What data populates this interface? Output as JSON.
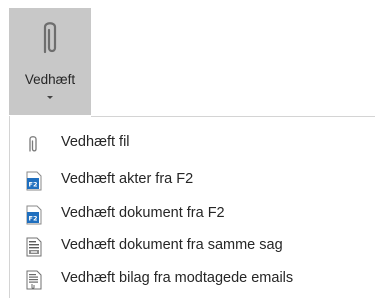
{
  "button": {
    "label": "Vedhæft",
    "icon": "paperclip-icon"
  },
  "menu": {
    "items": [
      {
        "label": "Vedhæft fil",
        "icon": "paperclip-icon"
      },
      {
        "label": "Vedhæft akter fra F2",
        "icon": "f2-document-icon",
        "icon_text": "F2"
      },
      {
        "label": "Vedhæft dokument fra F2",
        "icon": "f2-document-icon",
        "icon_text": "F2"
      },
      {
        "label": "Vedhæft dokument fra samme sag",
        "icon": "case-document-icon"
      },
      {
        "label": "Vedhæft bilag fra modtagede emails",
        "icon": "email-attachment-icon"
      }
    ]
  },
  "colors": {
    "button_bg": "#c8c8c8",
    "f2_blue": "#1f6fbf",
    "text": "#262626"
  }
}
